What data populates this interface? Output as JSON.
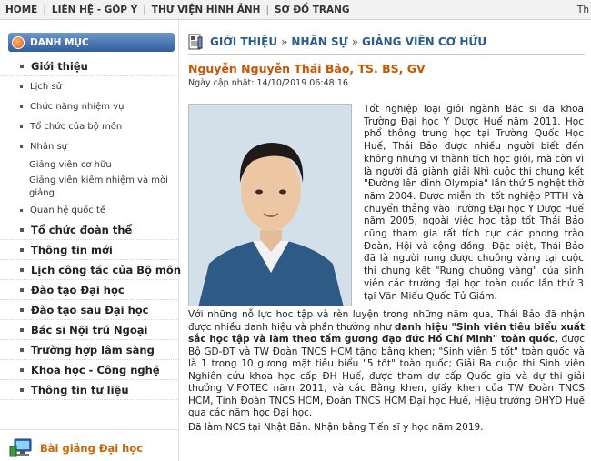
{
  "topnav": {
    "items": [
      "HOME",
      "LIÊN HỆ - GÓP Ý",
      "THƯ VIỆN HÌNH ẢNH",
      "SƠ ĐỒ TRANG"
    ],
    "right_text": "Th"
  },
  "sidebar": {
    "header": "DANH MỤC",
    "items": [
      {
        "label": "Giới thiệu",
        "level": "top"
      },
      {
        "label": "Lịch sử",
        "level": "sub"
      },
      {
        "label": "Chức năng nhiệm vụ",
        "level": "sub"
      },
      {
        "label": "Tổ chức của bộ môn",
        "level": "sub"
      },
      {
        "label": "Nhân sự",
        "level": "sub"
      },
      {
        "label": "Giảng viên cơ hữu",
        "level": "leaf"
      },
      {
        "label": "Giảng viên kiêm nhiệm và mời giảng",
        "level": "leaf"
      },
      {
        "label": "Quan hệ quốc tế",
        "level": "sub"
      },
      {
        "label": "Tổ chức đoàn thể",
        "level": "top"
      },
      {
        "label": "Thông tin mới",
        "level": "top"
      },
      {
        "label": "Lịch công tác của Bộ môn",
        "level": "top"
      },
      {
        "label": "Đào tạo Đại học",
        "level": "top"
      },
      {
        "label": "Đào tạo sau Đại học",
        "level": "top"
      },
      {
        "label": "Bác sĩ Nội trú Ngoại",
        "level": "top"
      },
      {
        "label": "Trường hợp lâm sàng",
        "level": "top"
      },
      {
        "label": "Khoa học - Công nghệ",
        "level": "top"
      },
      {
        "label": "Thông tin tư liệu",
        "level": "top"
      }
    ],
    "bottom_label": "Bài giảng Đại học"
  },
  "breadcrumb": {
    "parts": [
      "GIỚI THIỆU",
      "NHÂN SỰ",
      "GIẢNG VIÊN CƠ HỮU"
    ],
    "separator": "»"
  },
  "article": {
    "title": "Nguyễn Nguyễn Thái Bảo, TS. BS, GV",
    "updated": "Ngày cập nhật: 14/10/2019 06:48:16",
    "para1": "Tốt nghiệp loại giỏi ngành Bác sĩ đa khoa Trường Đại học Y Dược Huế năm 2011. Học phổ thông trung học tại Trường Quốc Học Huế, Thái Bảo được nhiều người biết đến không những vì thành tích học giỏi, mà còn vì là người đã giành giải Nhì cuộc thi chung kết \"Đường lên đỉnh Olympia\" lần thứ 5 nghệt thờ năm 2004. Được miễn thi tốt nghiệp PTTH và chuyển thẳng vào Trường Đại học Y Dược Huế năm 2005, ngoài việc học tập tốt Thái Bảo cũng tham gia rất tích cực các phong trào Đoàn, Hội và cộng đồng. Đặc biệt, Thái Bảo đã là người rung được chuông vàng tại cuộc thi chung kết \"Rung chuông vàng\" của sinh viên các trường đại học toàn quốc lần thứ 3 tại Văn Miếu Quốc Tử Giám.",
    "para2_a": "Với những nỗ lực học tập và rèn luyện trong những năm qua, Thái Bảo đã nhận được nhiều danh hiệu và phần thưởng như ",
    "para2_bold": "danh hiệu \"Sinh viên tiêu biểu xuất sắc học tập và làm theo tấm gương đạo đức Hồ Chí Minh\" toàn quốc,",
    "para2_b": " được Bộ GD-ĐT và TW Đoàn TNCS HCM tặng bằng khen; \"Sinh viên 5 tốt\" toàn quốc và là 1 trong 10 gương mặt tiêu biểu \"5 tốt\" toàn quốc; Giải Ba cuộc thi Sinh viên Nghiên cứu khoa học cấp ĐH Huế, được tham dự cấp Quốc gia và dự thi giải thưởng VIFOTEC năm 2011; và các Bằng khen, giấy khen của TW Đoàn TNCS HCM, Tỉnh Đoàn TNCS HCM, Đoàn TNCS HCM Đại học Huế, Hiệu trưởng ĐHYD Huế qua các năm học Đại học.",
    "para3": "Đã làm NCS tại Nhật Bản. Nhận bằng Tiến sĩ y học năm 2019."
  }
}
